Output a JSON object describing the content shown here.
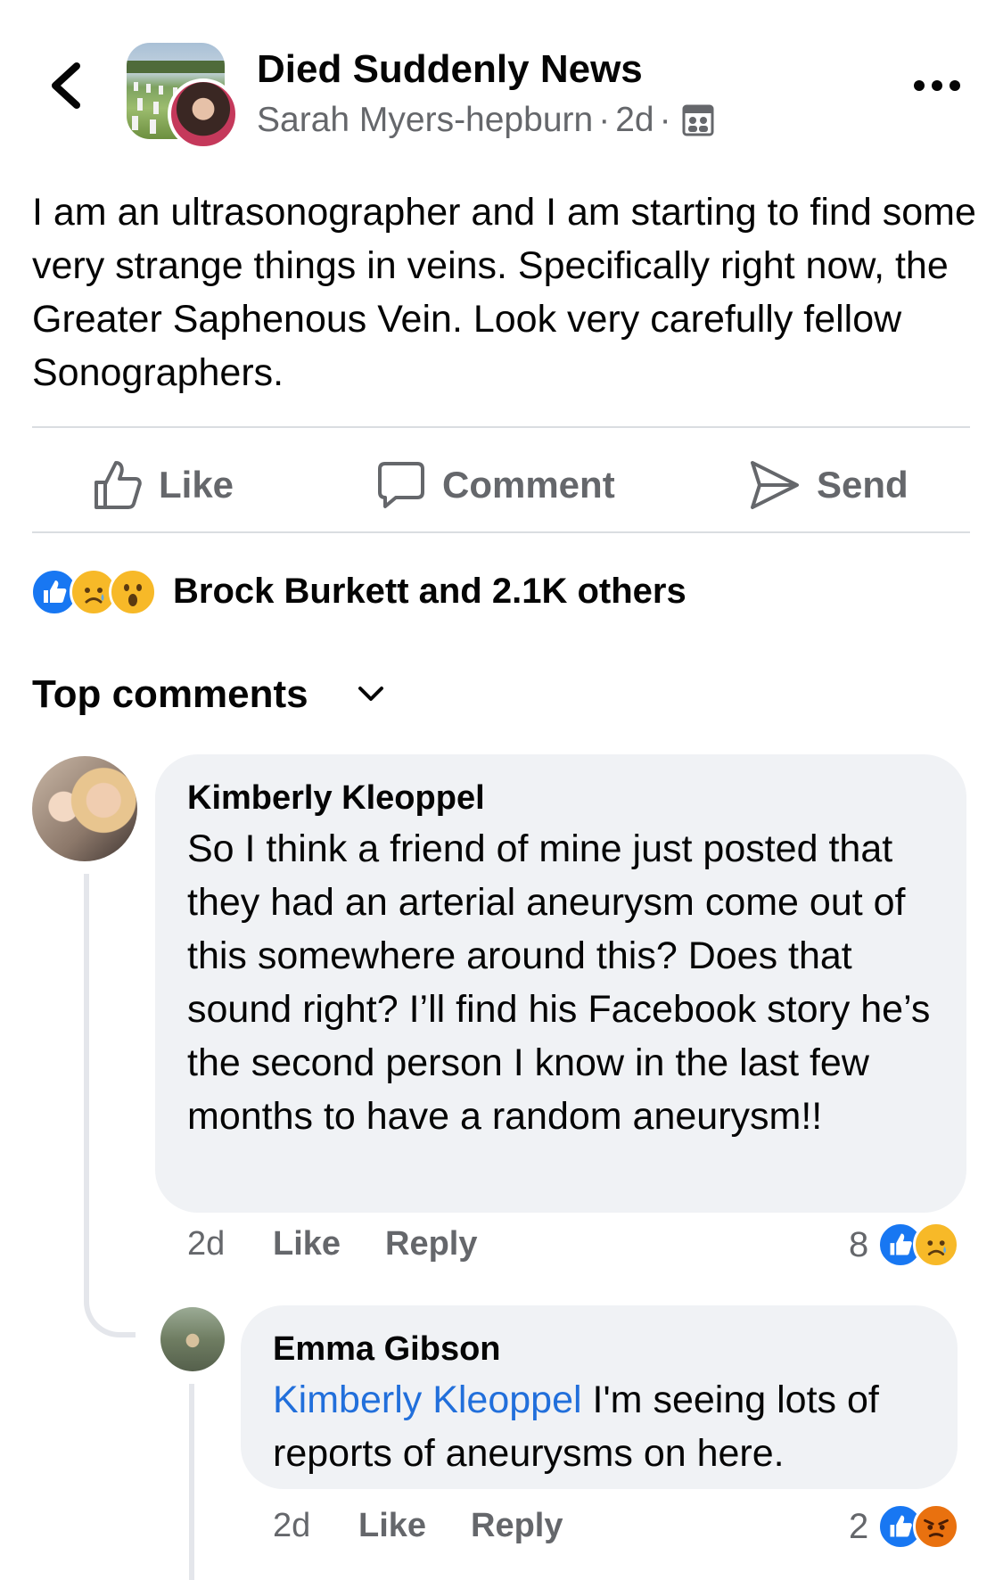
{
  "colors": {
    "like_blue": "#1877f2",
    "mention_blue": "#216fdb",
    "secondary_text": "#65676b",
    "bubble_bg": "#f0f2f5"
  },
  "header": {
    "group_name": "Died Suddenly News",
    "author": "Sarah Myers-hepburn",
    "time": "2d",
    "icons": [
      "back-chevron-icon",
      "group-members-icon",
      "more-options-icon"
    ]
  },
  "post": {
    "text": "I am an ultrasonographer and I am starting to find some very strange things in veins. Specifically right now, the Greater Saphenous Vein. Look very carefully fellow Sonographers."
  },
  "actions": {
    "like": "Like",
    "comment": "Comment",
    "send": "Send"
  },
  "reactions": {
    "summary": "Brock Burkett and 2.1K others",
    "types": [
      "like",
      "sad",
      "wow"
    ]
  },
  "comments_header": "Top comments",
  "comments": [
    {
      "author": "Kimberly Kleoppel",
      "text": "So I think a friend of mine just posted that they had an arterial aneurysm come out of this somewhere around this? Does that sound right? I’ll find his Facebook story he’s the second person I know in the last few months to have a random aneurysm!!",
      "time": "2d",
      "like": "Like",
      "reply": "Reply",
      "reaction_count": "8",
      "reaction_types": [
        "like",
        "sad"
      ]
    },
    {
      "author": "Emma Gibson",
      "mention": "Kimberly Kleoppel",
      "text": "I'm seeing lots of reports of aneurysms on here.",
      "time": "2d",
      "like": "Like",
      "reply": "Reply",
      "reaction_count": "2",
      "reaction_types": [
        "like",
        "angry"
      ]
    }
  ]
}
